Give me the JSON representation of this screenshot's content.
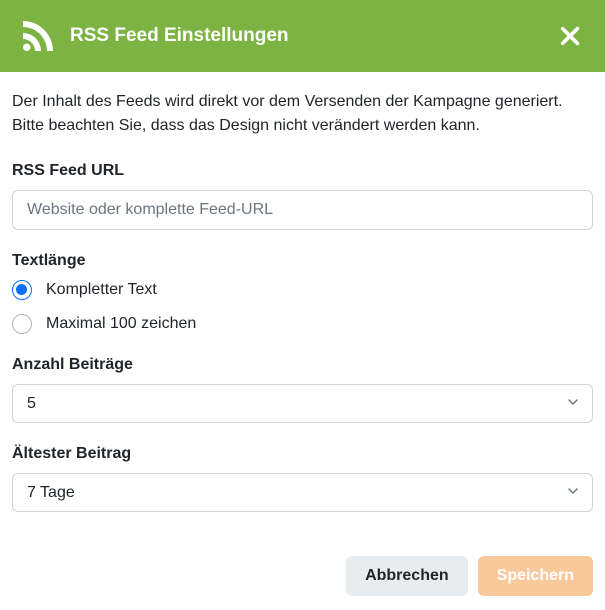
{
  "header": {
    "title": "RSS Feed Einstellungen",
    "icon": "rss-icon",
    "close_icon": "close-icon"
  },
  "description": "Der Inhalt des Feeds wird direkt vor dem Versenden der Kampagne generiert. Bitte beachten Sie, dass das Design nicht verändert werden kann.",
  "form": {
    "url": {
      "label": "RSS Feed URL",
      "placeholder": "Website oder komplette Feed-URL",
      "value": ""
    },
    "textlength": {
      "label": "Textlänge",
      "options": [
        {
          "label": "Kompletter Text",
          "value": "full",
          "checked": true
        },
        {
          "label": "Maximal 100 zeichen",
          "value": "max100",
          "checked": false
        }
      ]
    },
    "count": {
      "label": "Anzahl Beiträge",
      "selected": "5"
    },
    "oldest": {
      "label": "Ältester Beitrag",
      "selected": "7 Tage"
    }
  },
  "footer": {
    "cancel": "Abbrechen",
    "save": "Speichern"
  }
}
